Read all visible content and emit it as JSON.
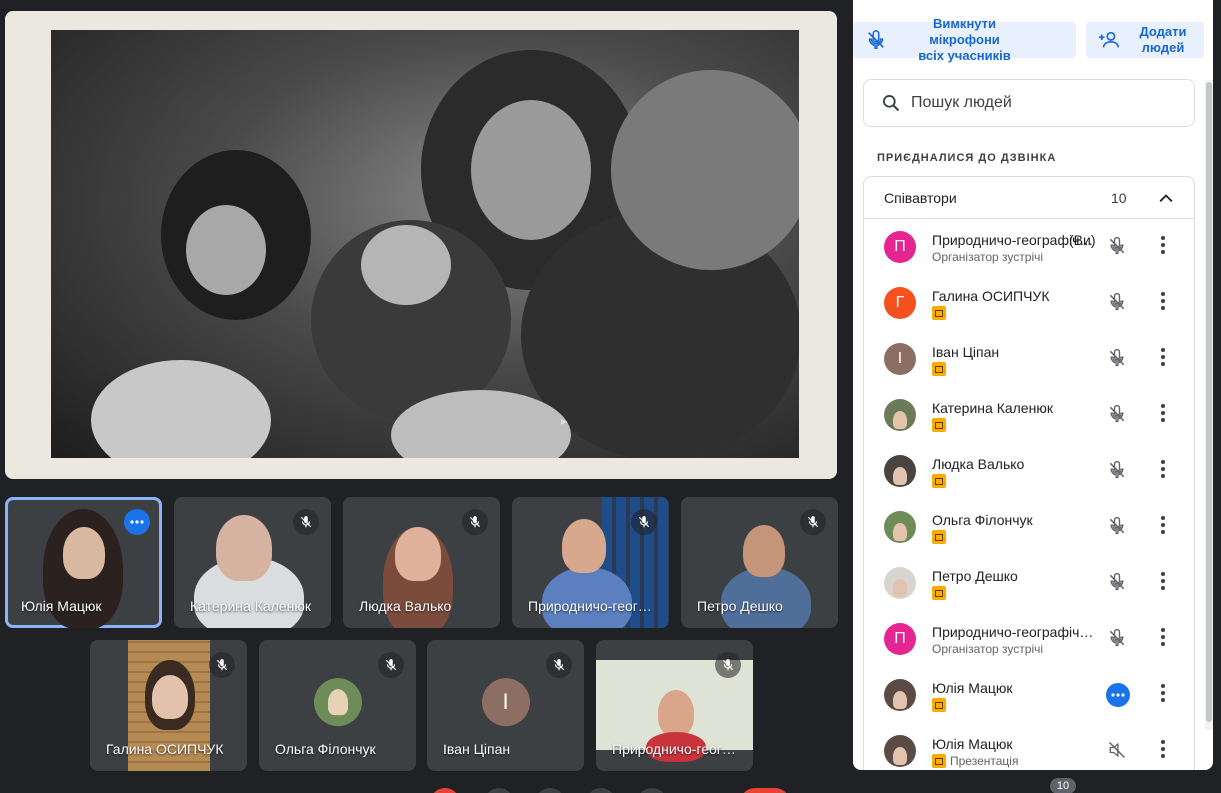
{
  "tiles": [
    {
      "name": "Юлія Мацюк",
      "bg": "#c9b89a"
    },
    {
      "name": "Катерина Каленюк",
      "bg": "#b9b1a6"
    },
    {
      "name": "Людка Валько",
      "bg": "#c47b6a"
    },
    {
      "name": "Природничо-географічний",
      "bg": "#4d5866"
    },
    {
      "name": "Петро Дешко",
      "bg": "#c7c0a8"
    },
    {
      "name": "Галина ОСИПЧУК",
      "bg": "#a48a60"
    },
    {
      "name": "Ольга Філончук",
      "bg": "#3c4043"
    },
    {
      "name": "Іван Ціпан",
      "bg": "#3c4043",
      "initial": "І",
      "avatar_color": "#8d6e63"
    },
    {
      "name": "Природничо-географічний",
      "bg": "#dcdfcf"
    }
  ],
  "panel": {
    "mute_all_line1": "Вимкнути мікрофони",
    "mute_all_line2": "всіх учасників",
    "add_people_line1": "Додати",
    "add_people_line2": "людей",
    "search_placeholder": "Пошук людей",
    "section_title": "ПРИЄДНАЛИСЯ ДО ДЗВІНКА",
    "group_title": "Співавтори",
    "group_count": "10",
    "you_label": "(Ви)",
    "participants": [
      {
        "name": "Природничо-географічний",
        "sub": "Організатор зустрічі",
        "initial": "П",
        "color": "#e52592"
      },
      {
        "name": "Галина ОСИПЧУК",
        "initial": "Г",
        "color": "#f4511e"
      },
      {
        "name": "Іван Ціпан",
        "initial": "І",
        "color": "#8d6e63"
      },
      {
        "name": "Катерина Каленюк",
        "color": "#6b7b5a"
      },
      {
        "name": "Людка Валько",
        "color": "#4a4440"
      },
      {
        "name": "Ольга Філончук",
        "color": "#6e8c58"
      },
      {
        "name": "Петро Дешко",
        "color": "#d8d4d0"
      },
      {
        "name": "Природничо-географічний",
        "sub": "Організатор зустрічі",
        "initial": "П",
        "color": "#e52592"
      },
      {
        "name": "Юлія Мацюк",
        "color": "#5a4b45"
      },
      {
        "name": "Юлія Мацюк",
        "sub": "Презентація",
        "color": "#5a4b45"
      }
    ]
  },
  "bottom_count": "10"
}
